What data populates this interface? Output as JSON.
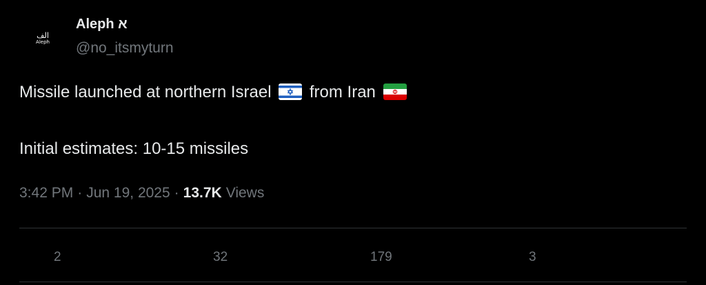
{
  "author": {
    "display_name": "Aleph א",
    "handle": "@no_itsmyturn",
    "avatar_text_arabic": "الف",
    "avatar_text_latin": "Aleph"
  },
  "post": {
    "line1_prefix": "Missile launched at northern Israel",
    "line1_middle": "from Iran",
    "line2": "Initial estimates: 10-15 missiles",
    "flag1": "flag-israel-icon",
    "flag2": "flag-iran-icon"
  },
  "meta": {
    "time": "3:42 PM",
    "separator": "·",
    "date": "Jun 19, 2025",
    "views_count": "13.7K",
    "views_label": "Views"
  },
  "actions": {
    "replies": "2",
    "reposts": "32",
    "likes": "179",
    "bookmarks": "3"
  },
  "colors": {
    "background": "#000000",
    "text_primary": "#e7e9ea",
    "text_secondary": "#71767b",
    "divider": "#2f3336"
  }
}
